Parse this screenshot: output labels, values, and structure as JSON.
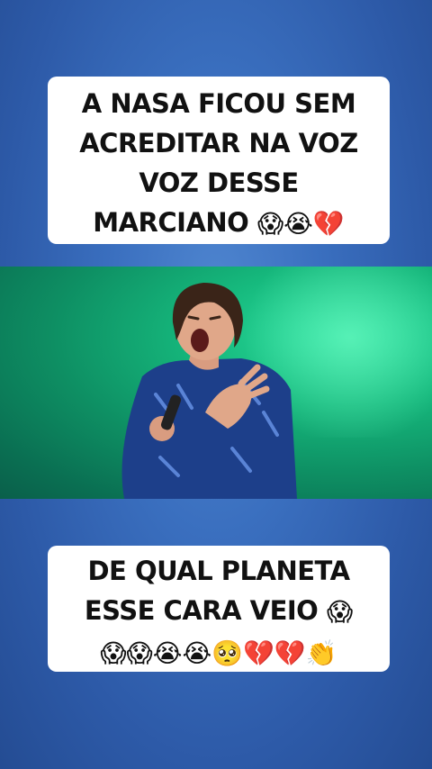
{
  "top_caption": {
    "lines": [
      "A NASA FICOU SEM",
      "ACREDITAR NA VOZ",
      "VOZ DESSE",
      "MARCIANO"
    ],
    "emojis": [
      "😱",
      "😭",
      "💔"
    ]
  },
  "video": {
    "description_icon": "singer-performing-icon",
    "colors": {
      "stage_green": "#16b97d",
      "jacket_blue": "#1d3f8a",
      "background_blue": "#3a6fbf"
    }
  },
  "bottom_caption": {
    "lines": [
      "DE QUAL PLANETA",
      "ESSE CARA VEIO"
    ],
    "line2_emoji": "😱",
    "emojis_row": [
      "😱",
      "😱",
      "😭",
      "😭",
      "🥺",
      "💔",
      "💔",
      "👏"
    ]
  }
}
